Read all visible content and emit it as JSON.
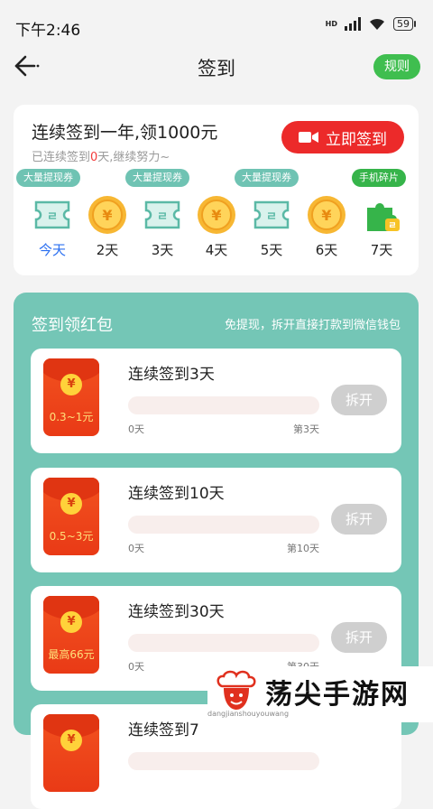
{
  "status_bar": {
    "time": "下午2:46",
    "battery": "59",
    "network": "HD"
  },
  "nav": {
    "title": "签到",
    "rules_label": "规则"
  },
  "checkin": {
    "title": "连续签到一年,领1000元",
    "sub_prefix": "已连续签到",
    "sub_count": "0",
    "sub_suffix": "天,继续努力~",
    "button_label": "立即签到",
    "tags": [
      "大量提现券",
      "大量提现券",
      "大量提现券",
      "手机碎片"
    ],
    "days": [
      {
        "label": "今天",
        "icon": "ticket-icon"
      },
      {
        "label": "2天",
        "icon": "coin-icon"
      },
      {
        "label": "3天",
        "icon": "ticket-icon"
      },
      {
        "label": "4天",
        "icon": "coin-icon"
      },
      {
        "label": "5天",
        "icon": "ticket-icon"
      },
      {
        "label": "6天",
        "icon": "coin-icon"
      },
      {
        "label": "7天",
        "icon": "puzzle-icon"
      }
    ],
    "coin_symbol": "¥",
    "ticket_glyph": "ㄹ"
  },
  "redpacket": {
    "title": "签到领红包",
    "note": "免提现，拆开直接打款到微信钱包",
    "items": [
      {
        "title": "连续签到3天",
        "amount": "0.3~1元",
        "start": "0天",
        "end": "第3天",
        "button": "拆开",
        "progress": 0
      },
      {
        "title": "连续签到10天",
        "amount": "0.5~3元",
        "start": "0天",
        "end": "第10天",
        "button": "拆开",
        "progress": 0
      },
      {
        "title": "连续签到30天",
        "amount": "最高66元",
        "start": "0天",
        "end": "第30天",
        "button": "拆开",
        "progress": 0
      },
      {
        "title": "连续签到7",
        "amount": "",
        "start": "",
        "end": "",
        "button": "",
        "progress": 0
      }
    ]
  },
  "watermark": {
    "brand": "荡尖手游网",
    "url": "dangjianshouyouwang"
  },
  "colors": {
    "accent_green": "#3fbe4f",
    "panel_teal": "#74c6b6",
    "sign_red": "#ec2a2a",
    "today_blue": "#2b6ff0"
  }
}
